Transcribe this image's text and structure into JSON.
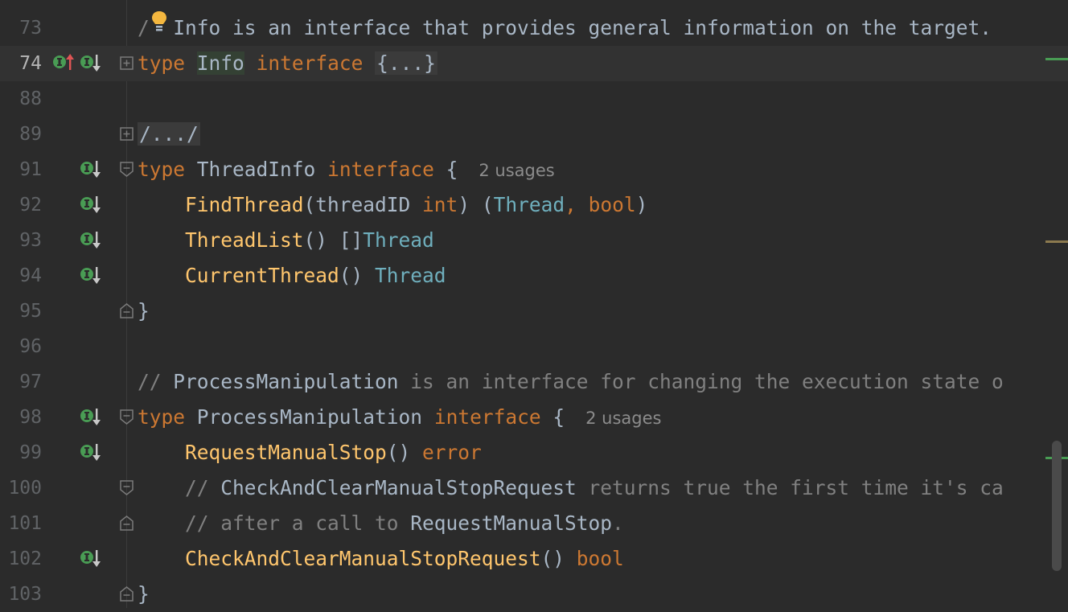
{
  "editor": {
    "lines": [
      {
        "num": "73"
      },
      {
        "num": "74"
      },
      {
        "num": "88"
      },
      {
        "num": "89"
      },
      {
        "num": "91"
      },
      {
        "num": "92"
      },
      {
        "num": "93"
      },
      {
        "num": "94"
      },
      {
        "num": "95"
      },
      {
        "num": "96"
      },
      {
        "num": "97"
      },
      {
        "num": "98"
      },
      {
        "num": "99"
      },
      {
        "num": "100"
      },
      {
        "num": "101"
      },
      {
        "num": "102"
      },
      {
        "num": "103"
      }
    ],
    "tokens": {
      "l73_cm_slash": "/",
      "l73_text": " Info is an interface that provides general information on the target.",
      "l74_type": "type",
      "l74_name": "Info",
      "l74_interface": "interface",
      "l74_folded": "{...}",
      "l89_folded": "/.../",
      "l91_type": "type",
      "l91_name": "ThreadInfo",
      "l91_interface": "interface",
      "l91_brace": "{",
      "l91_usages": "2 usages",
      "l92_fn": "FindThread",
      "l92_open": "(threadID ",
      "l92_int": "int",
      "l92_mid": ") (",
      "l92_thread": "Thread",
      "l92_comma": ", ",
      "l92_bool": "bool",
      "l92_close": ")",
      "l93_fn": "ThreadList",
      "l93_parens": "() []",
      "l93_thread": "Thread",
      "l94_fn": "CurrentThread",
      "l94_parens": "() ",
      "l94_thread": "Thread",
      "l95_brace": "}",
      "l97_cm": "// ",
      "l97_name": "ProcessManipulation",
      "l97_text": " is an interface for changing the execution state o",
      "l98_type": "type",
      "l98_name": "ProcessManipulation",
      "l98_interface": "interface",
      "l98_brace": "{",
      "l98_usages": "2 usages",
      "l99_fn": "RequestManualStop",
      "l99_parens": "() ",
      "l99_error": "error",
      "l100_cm": "// ",
      "l100_name": "CheckAndClearManualStopRequest",
      "l100_text": " returns true the first time it's ca",
      "l101_cm": "// after a call to ",
      "l101_name": "RequestManualStop",
      "l101_dot": ".",
      "l102_fn": "CheckAndClearManualStopRequest",
      "l102_parens": "() ",
      "l102_bool": "bool",
      "l103_brace": "}"
    }
  },
  "colors": {
    "background": "#2b2b2b",
    "keyword": "#cc7832",
    "function": "#ffc66d",
    "type": "#6fafbd",
    "comment": "#808080",
    "implements_icon": "#499c54"
  },
  "icons": {
    "bulb": "lightbulb-icon",
    "implementing": "implementing-method-icon",
    "implemented": "implemented-interface-icon",
    "fold": "fold-toggle-icon"
  }
}
